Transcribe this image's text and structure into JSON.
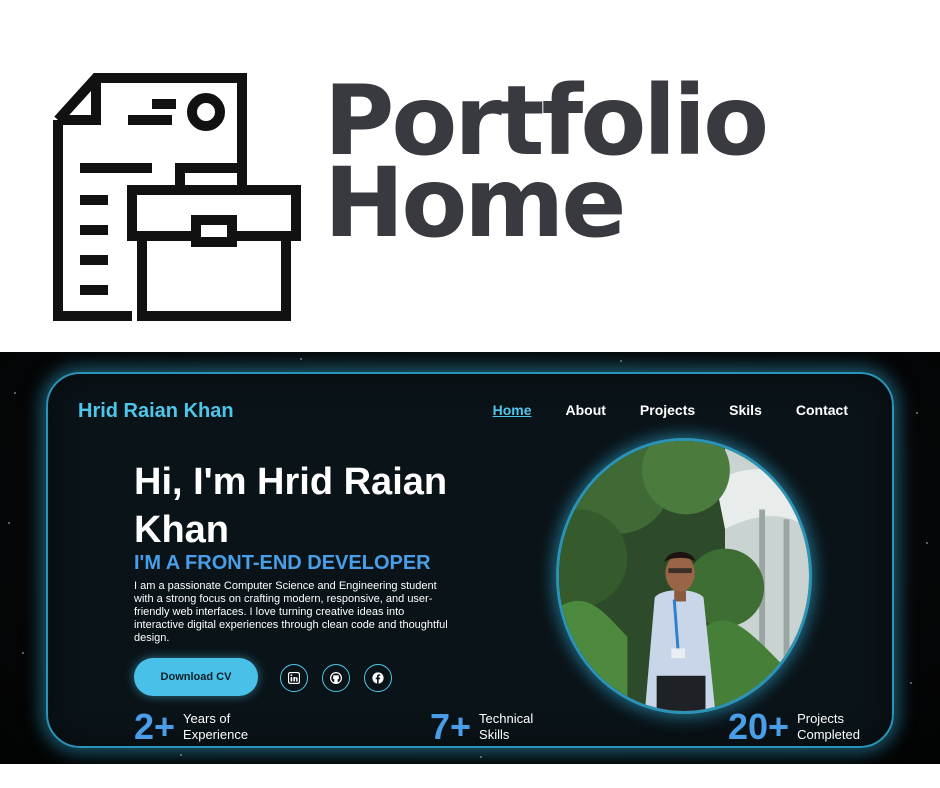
{
  "banner": {
    "title_line1": "Portfolio",
    "title_line2": "Home",
    "icon": "portfolio-document-briefcase-icon"
  },
  "site": {
    "brand": "Hrid Raian Khan",
    "nav": [
      "Home",
      "About",
      "Projects",
      "Skils",
      "Contact"
    ],
    "active_nav": "Home"
  },
  "hero": {
    "title": "Hi, I'm Hrid Raian Khan",
    "subtitle": "I'M A FRONT-END DEVELOPER",
    "description": "I am a passionate Computer Science and Engineering student with a strong focus on crafting modern, responsive, and user-friendly web interfaces. I love turning creative ideas into interactive digital experiences through clean code and thoughtful design.",
    "cv_button": "Download CV",
    "social_icons": [
      "linkedin-icon",
      "github-icon",
      "facebook-icon"
    ]
  },
  "stats": [
    {
      "number": "2+",
      "label": "Years of Experience"
    },
    {
      "number": "7+",
      "label": "Technical Skills"
    },
    {
      "number": "20+",
      "label": "Projects Completed"
    }
  ],
  "colors": {
    "accent": "#4fc6e9",
    "accent_blue": "#4a9ee8",
    "card_border": "#2a93b6",
    "banner_text": "#383a40"
  }
}
